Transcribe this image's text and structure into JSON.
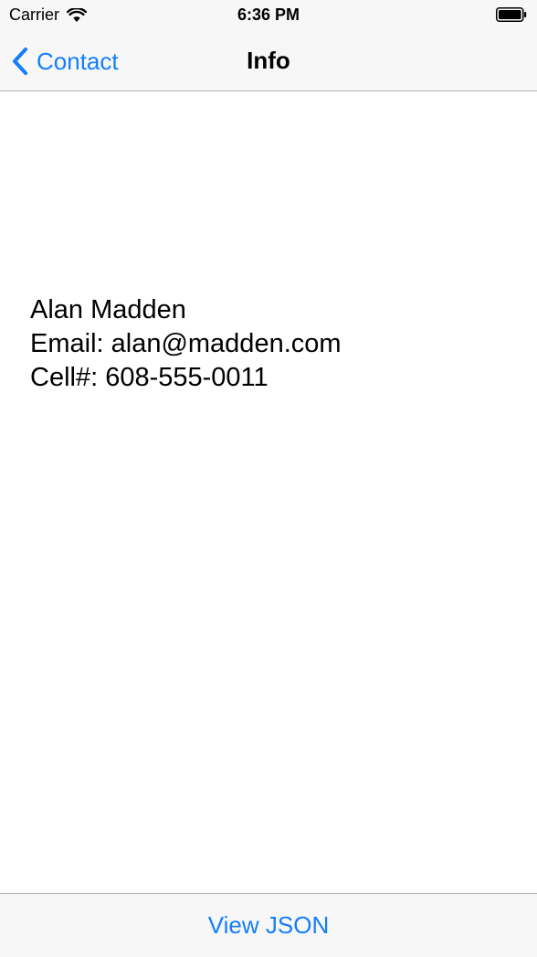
{
  "status_bar": {
    "carrier": "Carrier",
    "time": "6:36 PM",
    "icons": [
      "wifi-icon",
      "battery-icon"
    ]
  },
  "nav_bar": {
    "back_label": "Contact",
    "back_icon": "chevron-left-icon",
    "title": "Info"
  },
  "contact": {
    "name": "Alan Madden",
    "email_line": "Email: alan@madden.com",
    "cell_line": "Cell#: 608-555-0011"
  },
  "toolbar": {
    "view_json_label": "View JSON"
  },
  "colors": {
    "accent": "#157efb",
    "bar_background": "#f7f7f7",
    "separator": "#b2b2b2"
  }
}
